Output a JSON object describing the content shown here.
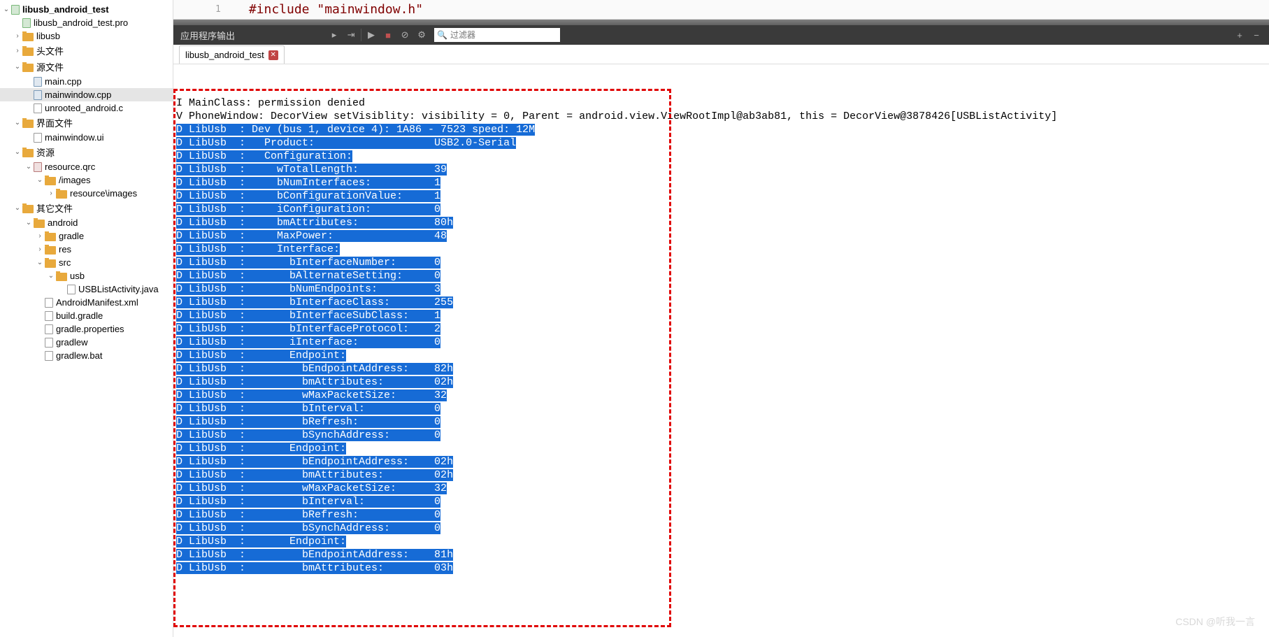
{
  "tree": [
    {
      "level": 0,
      "chev": "v",
      "icon": "pro",
      "label": "libusb_android_test",
      "bold": true
    },
    {
      "level": 1,
      "chev": "",
      "icon": "pro",
      "label": "libusb_android_test.pro"
    },
    {
      "level": 1,
      "chev": ">",
      "icon": "folder",
      "label": "libusb"
    },
    {
      "level": 1,
      "chev": ">",
      "icon": "folder",
      "label": "头文件"
    },
    {
      "level": 1,
      "chev": "v",
      "icon": "folder",
      "label": "源文件"
    },
    {
      "level": 2,
      "chev": "",
      "icon": "cpp",
      "label": "main.cpp"
    },
    {
      "level": 2,
      "chev": "",
      "icon": "cpp",
      "label": "mainwindow.cpp",
      "selected": true
    },
    {
      "level": 2,
      "chev": "",
      "icon": "file",
      "label": "unrooted_android.c"
    },
    {
      "level": 1,
      "chev": "v",
      "icon": "folder",
      "label": "界面文件"
    },
    {
      "level": 2,
      "chev": "",
      "icon": "file",
      "label": "mainwindow.ui"
    },
    {
      "level": 1,
      "chev": "v",
      "icon": "folder",
      "label": "资源"
    },
    {
      "level": 2,
      "chev": "v",
      "icon": "qrc",
      "label": "resource.qrc"
    },
    {
      "level": 3,
      "chev": "v",
      "icon": "folder",
      "label": "/images"
    },
    {
      "level": 4,
      "chev": ">",
      "icon": "folder",
      "label": "resource\\images"
    },
    {
      "level": 1,
      "chev": "v",
      "icon": "folder",
      "label": "其它文件"
    },
    {
      "level": 2,
      "chev": "v",
      "icon": "folder",
      "label": "android"
    },
    {
      "level": 3,
      "chev": ">",
      "icon": "folder",
      "label": "gradle"
    },
    {
      "level": 3,
      "chev": ">",
      "icon": "folder",
      "label": "res"
    },
    {
      "level": 3,
      "chev": "v",
      "icon": "folder",
      "label": "src"
    },
    {
      "level": 4,
      "chev": "v",
      "icon": "folder",
      "label": "usb"
    },
    {
      "level": 5,
      "chev": "",
      "icon": "file",
      "label": "USBListActivity.java"
    },
    {
      "level": 3,
      "chev": "",
      "icon": "file",
      "label": "AndroidManifest.xml"
    },
    {
      "level": 3,
      "chev": "",
      "icon": "file",
      "label": "build.gradle"
    },
    {
      "level": 3,
      "chev": "",
      "icon": "file",
      "label": "gradle.properties"
    },
    {
      "level": 3,
      "chev": "",
      "icon": "file",
      "label": "gradlew"
    },
    {
      "level": 3,
      "chev": "",
      "icon": "file",
      "label": "gradlew.bat"
    }
  ],
  "editor": {
    "line_num": "1",
    "code": "#include \"mainwindow.h\""
  },
  "output_panel": {
    "title": "应用程序输出",
    "filter_placeholder": "过滤器",
    "tab_label": "libusb_android_test"
  },
  "console_lines": [
    {
      "text": "I MainClass: permission denied",
      "selected": false
    },
    {
      "text": "V PhoneWindow: DecorView setVisiblity: visibility = 0, Parent = android.view.ViewRootImpl@ab3ab81, this = DecorView@3878426[USBListActivity]",
      "selected": false
    },
    {
      "text": "D LibUsb  : Dev (bus 1, device 4): 1A86 - 7523 speed: 12M",
      "selected": true
    },
    {
      "text": "D LibUsb  :   Product:                   USB2.0-Serial",
      "selected": true
    },
    {
      "text": "D LibUsb  :   Configuration:",
      "selected": true
    },
    {
      "text": "D LibUsb  :     wTotalLength:            39",
      "selected": true
    },
    {
      "text": "D LibUsb  :     bNumInterfaces:          1",
      "selected": true
    },
    {
      "text": "D LibUsb  :     bConfigurationValue:     1",
      "selected": true
    },
    {
      "text": "D LibUsb  :     iConfiguration:          0",
      "selected": true
    },
    {
      "text": "D LibUsb  :     bmAttributes:            80h",
      "selected": true
    },
    {
      "text": "D LibUsb  :     MaxPower:                48",
      "selected": true
    },
    {
      "text": "D LibUsb  :     Interface:",
      "selected": true
    },
    {
      "text": "D LibUsb  :       bInterfaceNumber:      0",
      "selected": true
    },
    {
      "text": "D LibUsb  :       bAlternateSetting:     0",
      "selected": true
    },
    {
      "text": "D LibUsb  :       bNumEndpoints:         3",
      "selected": true
    },
    {
      "text": "D LibUsb  :       bInterfaceClass:       255",
      "selected": true
    },
    {
      "text": "D LibUsb  :       bInterfaceSubClass:    1",
      "selected": true
    },
    {
      "text": "D LibUsb  :       bInterfaceProtocol:    2",
      "selected": true
    },
    {
      "text": "D LibUsb  :       iInterface:            0",
      "selected": true
    },
    {
      "text": "D LibUsb  :       Endpoint:",
      "selected": true
    },
    {
      "text": "D LibUsb  :         bEndpointAddress:    82h",
      "selected": true
    },
    {
      "text": "D LibUsb  :         bmAttributes:        02h",
      "selected": true
    },
    {
      "text": "D LibUsb  :         wMaxPacketSize:      32",
      "selected": true
    },
    {
      "text": "D LibUsb  :         bInterval:           0",
      "selected": true
    },
    {
      "text": "D LibUsb  :         bRefresh:            0",
      "selected": true
    },
    {
      "text": "D LibUsb  :         bSynchAddress:       0",
      "selected": true
    },
    {
      "text": "D LibUsb  :       Endpoint:",
      "selected": true
    },
    {
      "text": "D LibUsb  :         bEndpointAddress:    02h",
      "selected": true
    },
    {
      "text": "D LibUsb  :         bmAttributes:        02h",
      "selected": true
    },
    {
      "text": "D LibUsb  :         wMaxPacketSize:      32",
      "selected": true
    },
    {
      "text": "D LibUsb  :         bInterval:           0",
      "selected": true
    },
    {
      "text": "D LibUsb  :         bRefresh:            0",
      "selected": true
    },
    {
      "text": "D LibUsb  :         bSynchAddress:       0",
      "selected": true
    },
    {
      "text": "D LibUsb  :       Endpoint:",
      "selected": true
    },
    {
      "text": "D LibUsb  :         bEndpointAddress:    81h",
      "selected": true
    },
    {
      "text": "D LibUsb  :         bmAttributes:        03h",
      "selected": true
    }
  ],
  "watermark": "CSDN @听我一言"
}
